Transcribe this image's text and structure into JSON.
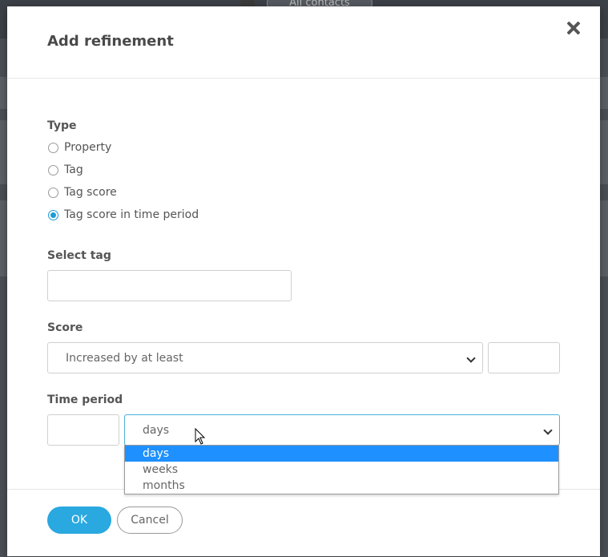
{
  "background": {
    "contact_filter_label": "All contacts"
  },
  "modal": {
    "title": "Add refinement",
    "type": {
      "label": "Type",
      "options": [
        "Property",
        "Tag",
        "Tag score",
        "Tag score in time period"
      ],
      "selected": "Tag score in time period"
    },
    "select_tag": {
      "label": "Select tag",
      "value": ""
    },
    "score": {
      "label": "Score",
      "comparison": "Increased by at least",
      "value": ""
    },
    "time_period": {
      "label": "Time period",
      "amount": "",
      "unit": "days",
      "unit_options": [
        "days",
        "weeks",
        "months"
      ]
    },
    "buttons": {
      "ok": "OK",
      "cancel": "Cancel"
    }
  },
  "colors": {
    "accent": "#2aa8e0",
    "option_highlight": "#1e90ff"
  },
  "icons": {
    "close": "close-icon",
    "chevron": "chevron-down-icon",
    "cursor": "mouse-pointer-icon"
  }
}
